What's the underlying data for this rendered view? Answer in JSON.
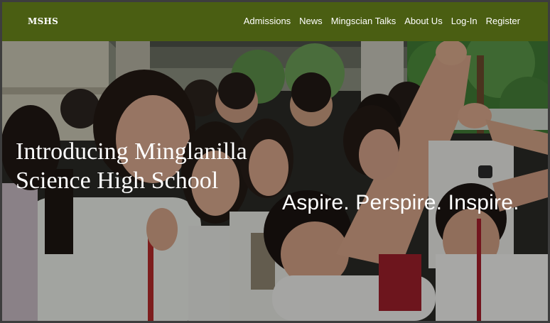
{
  "navbar": {
    "brand": "MSHS",
    "links": [
      {
        "label": "Admissions"
      },
      {
        "label": "News"
      },
      {
        "label": "Mingscian Talks"
      },
      {
        "label": "About Us"
      },
      {
        "label": "Log-In"
      },
      {
        "label": "Register"
      }
    ],
    "background_color": "#4a5e12"
  },
  "hero": {
    "title": "Introducing Minglanilla Science High School",
    "tagline": "Aspire. Perspire. Inspire."
  }
}
